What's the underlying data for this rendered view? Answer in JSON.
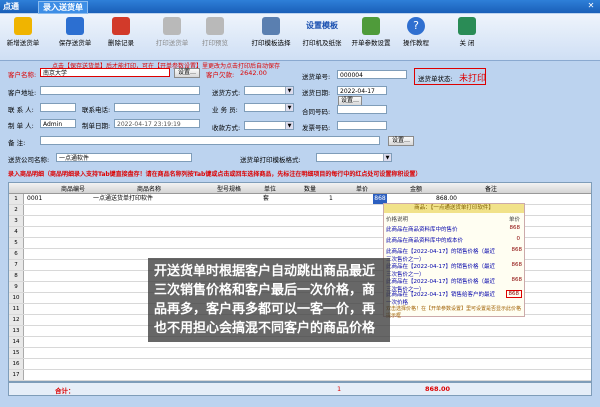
{
  "window": {
    "app_title": "点通",
    "form_title": "录入送货单",
    "close_icon": "close-icon"
  },
  "toolbar": [
    {
      "label": "新增送货单",
      "icon": "new-doc-icon",
      "color": "#f0b400",
      "enabled": true
    },
    {
      "label": "保存送货单",
      "icon": "save-icon",
      "color": "#2c6fd1",
      "enabled": true
    },
    {
      "label": "删除记录",
      "icon": "delete-icon",
      "color": "#d23a2a",
      "enabled": true
    },
    {
      "label": "打印送货单",
      "icon": "print-icon",
      "color": "#888888",
      "enabled": false
    },
    {
      "label": "打印预览",
      "icon": "preview-icon",
      "color": "#888888",
      "enabled": false
    },
    {
      "label": "打印模板选择",
      "icon": "template-icon",
      "color": "#5a7fb0",
      "enabled": true
    },
    {
      "label": "设置模板",
      "sub": "打印机及纸张",
      "icon": "printer-setup-icon",
      "color": "#4a4a4a",
      "enabled": true
    },
    {
      "label": "开单参数设置",
      "icon": "settings-icon",
      "color": "#4f9b3a",
      "enabled": true
    },
    {
      "label": "操作教程",
      "icon": "help-icon",
      "color": "#2f6fd0",
      "enabled": true
    },
    {
      "label": "关 闭",
      "icon": "exit-icon",
      "color": "#2a8c56",
      "enabled": true
    }
  ],
  "hint": "点击【保存送货单】后才能打印，可在【开单参数设置】里更改为点击打印后自动保存",
  "form": {
    "customer_label": "客户名称:",
    "customer_value": "南京大学",
    "settings_btn": "设置…",
    "receivable_label": "客户欠款:",
    "receivable_value": "2642.00",
    "order_no_label": "送货单号:",
    "order_no_value": "000004",
    "status_label": "送货单状态:",
    "status_value": "未打印",
    "address_label": "客户地址:",
    "ship_method_label": "送货方式:",
    "ship_date_label": "送货日期:",
    "ship_date_value": "2022-04-17",
    "contact_label": "联 系 人:",
    "phone_label": "联系电话:",
    "salesman_label": "业 务 员:",
    "contract_label": "合同号码:",
    "maker_label": "制 单 人:",
    "maker_value": "Admin",
    "make_date_label": "制单日期:",
    "make_date_value": "2022-04-17 23:19:19",
    "pay_method_label": "收款方式:",
    "invoice_label": "发票号码:",
    "remark_label": "备   注:",
    "company_label": "送货公司名称:",
    "company_value": "一点通软件",
    "template_label": "送货单打印模板格式:"
  },
  "grid_notice": "录入商品明细（商品明细录入支持Tab键直接盘存！请在商品名称列按Tab键或点击或回车选择商品，先标注在明细项目的每行中的红点处可设置称积设置）",
  "grid": {
    "headers": [
      "商品编号",
      "商品名称",
      "型号规格",
      "单位",
      "数量",
      "单价",
      "金额",
      "备注"
    ],
    "row1": {
      "no": "1",
      "code": "0001",
      "name": "一点通送货单打印软件",
      "unit": "套",
      "qty": "1",
      "price": "868",
      "amount": "868.00"
    },
    "total_label": "合计：",
    "total_qty": "1",
    "total_amount": "868.00"
  },
  "popup": {
    "title": "商品：【一点通送货单打印软件】",
    "col1": "价格说明",
    "col2": "单价",
    "rows": [
      {
        "desc": "此商品在商品资料库中的售价",
        "val": "868"
      },
      {
        "desc": "此商品在商品资料库中的成本价",
        "val": "0"
      },
      {
        "desc": "此商品在【2022-04-17】的销售价格（最近三次售价之一）",
        "val": "868"
      },
      {
        "desc": "此商品在【2022-04-17】的销售价格（最近三次售价之一）",
        "val": "868"
      },
      {
        "desc": "此商品在【2022-04-17】的销售价格（最近三次售价之一）",
        "val": "868"
      },
      {
        "desc": "此商品在【2022-04-17】销售给客户的最近一次价格",
        "val": "868"
      }
    ],
    "footer": "双击选择价格！在【开单参数设置】里可设置是否显示此价格提示框"
  },
  "annotation": "开送货单时根据客户自动跳出商品最近三次销售价格和客户最后一次价格，商品再多，客户再多都可以一客一价，再也不用担心会搞混不同客户的商品价格"
}
